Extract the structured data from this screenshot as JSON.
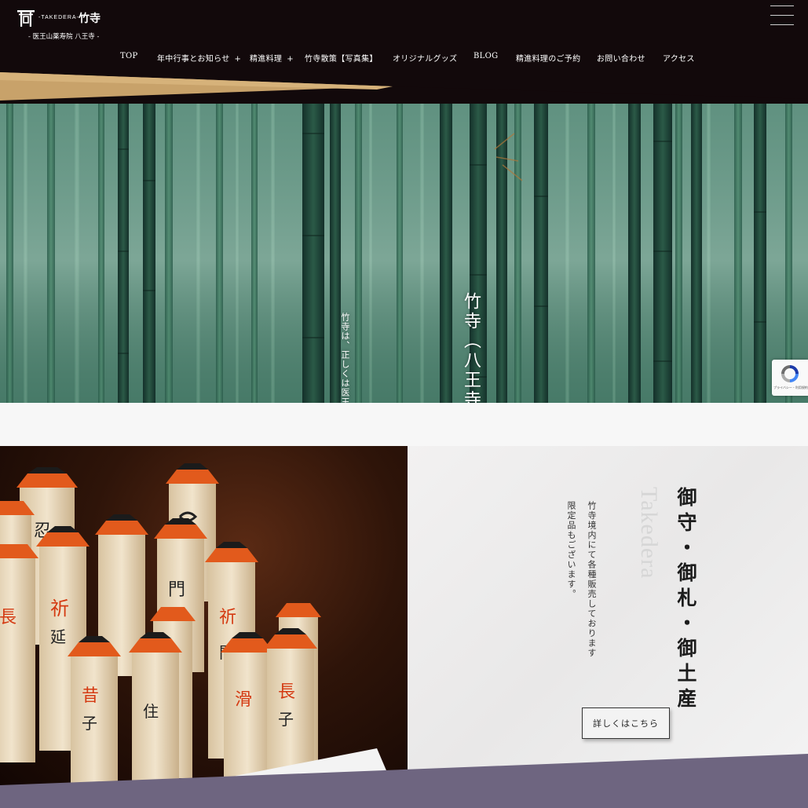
{
  "header": {
    "logo": {
      "sub": "-TAKEDERA-",
      "main": "竹寺",
      "tagline": "- 医王山薬寿院 八王寺 -"
    },
    "menu_icon": "hamburger-menu-icon"
  },
  "nav": {
    "items": [
      {
        "label": "TOP",
        "has_submenu": false
      },
      {
        "label": "年中行事とお知らせ",
        "has_submenu": true
      },
      {
        "label": "精進料理",
        "has_submenu": true
      },
      {
        "label": "竹寺散策【写真集】",
        "has_submenu": false
      },
      {
        "label": "オリジナルグッズ",
        "has_submenu": false
      },
      {
        "label": "BLOG",
        "has_submenu": false
      },
      {
        "label": "精進料理のご予約",
        "has_submenu": false
      },
      {
        "label": "お問い合わせ",
        "has_submenu": false
      },
      {
        "label": "アクセス",
        "has_submenu": false
      }
    ],
    "submenu_marker": "+"
  },
  "hero": {
    "title": "竹寺（八王寺）",
    "body": "竹寺は、正しくは医王山薬寿院八王寺といい山岳信仰の道場として千年余の歴史を有しております。",
    "image": "bamboo-forest"
  },
  "recaptcha": {
    "text": "プライバシー・利用規約",
    "icon": "recaptcha-icon"
  },
  "goods": {
    "title": "御守・御札・御土産",
    "watermark": "Takedera",
    "body": "竹寺境内にて各種販売しております限定品もございます。",
    "button_label": "詳しくはこちら",
    "image": "omamori-charms"
  },
  "colors": {
    "header_bg": "#12090b",
    "gold_accent": "#c8a26a",
    "purple_band": "#6e6580",
    "paper": "#f2f2f2"
  }
}
